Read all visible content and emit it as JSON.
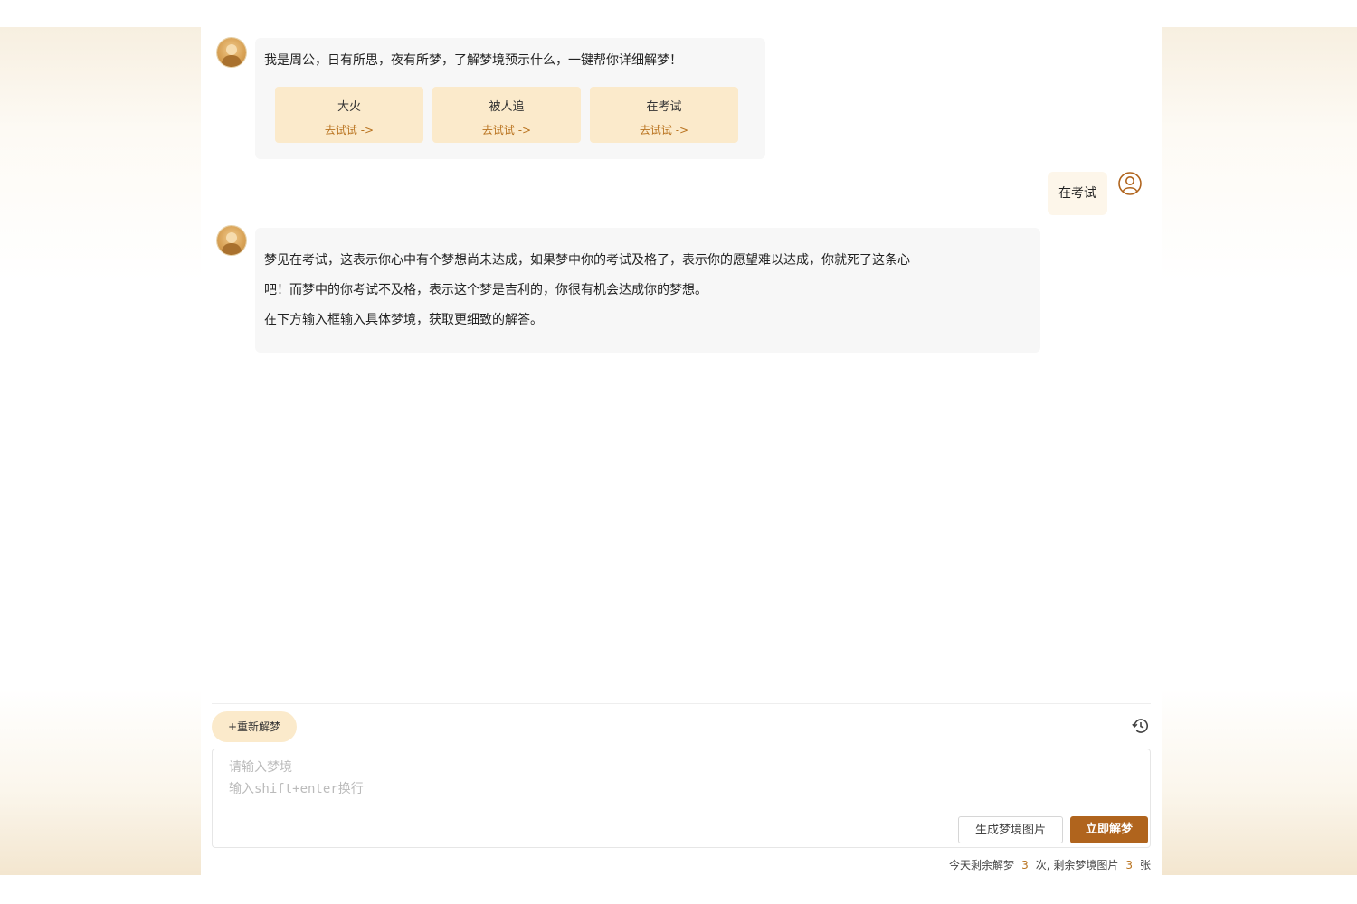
{
  "greeting": {
    "text": "我是周公，日有所思，夜有所梦，了解梦境预示什么，一键帮你详细解梦！",
    "suggestions": [
      {
        "topic": "大火",
        "try": "去试试 ->"
      },
      {
        "topic": "被人追",
        "try": "去试试 ->"
      },
      {
        "topic": "在考试",
        "try": "去试试 ->"
      }
    ]
  },
  "user_message": "在考试",
  "answer": {
    "lines": [
      "梦见在考试，这表示你心中有个梦想尚未达成，如果梦中你的考试及格了，表示你的愿望难以达成，你就死了这条心",
      "吧！而梦中的你考试不及格，表示这个梦是吉利的，你很有机会达成你的梦想。",
      "在下方输入框输入具体梦境，获取更细致的解答。"
    ]
  },
  "toolbar": {
    "new_label": "+重新解梦"
  },
  "input": {
    "placeholder": "请输入梦境\n输入shift+enter换行"
  },
  "buttons": {
    "generate_label": "生成梦境图片",
    "interpret_label": "立即解梦"
  },
  "quota": {
    "prefix": "今天剩余解梦",
    "dream_count": "3",
    "mid": "次, 剩余梦境图片",
    "image_count": "3",
    "suffix": "张"
  },
  "colors": {
    "accent": "#b0641d",
    "suggest_bg": "#fbeacb",
    "link": "#b9731f"
  }
}
